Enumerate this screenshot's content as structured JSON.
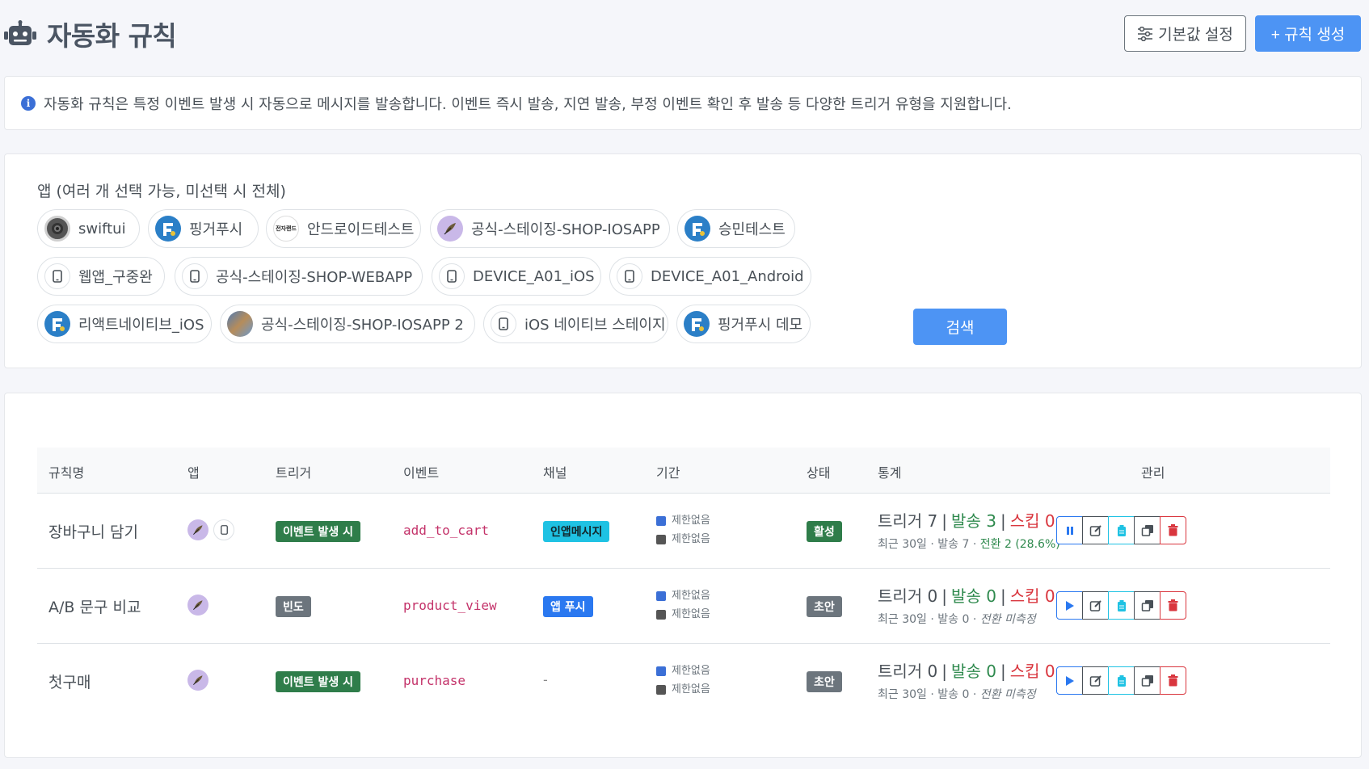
{
  "header": {
    "title": "자동화 규칙",
    "defaults_button": "기본값 설정",
    "create_button": "+ 규칙 생성"
  },
  "info": {
    "text": "자동화 규칙은 특정 이벤트 발생 시 자동으로 메시지를 발송합니다. 이벤트 즉시 발송, 지연 발송, 부정 이벤트 확인 후 발송 등 다양한 트리거 유형을 지원합니다."
  },
  "filter": {
    "label": "앱 (여러 개 선택 가능, 미선택 시 전체)",
    "search_button": "검색",
    "apps": [
      {
        "name": "swiftui",
        "icon": "swift-app-icon"
      },
      {
        "name": "핑거푸시",
        "icon": "fingerpush-logo-icon"
      },
      {
        "name": "안드로이드테스트",
        "icon": "text-logo-icon",
        "icon_text": "전자랜드"
      },
      {
        "name": "공식-스테이징-SHOP-IOSAPP",
        "icon": "feather-app-icon"
      },
      {
        "name": "승민테스트",
        "icon": "fingerpush-logo-icon"
      },
      {
        "name": "웹앱_구중완",
        "icon": "device-icon"
      },
      {
        "name": "공식-스테이징-SHOP-WEBAPP",
        "icon": "device-icon"
      },
      {
        "name": "DEVICE_A01_iOS",
        "icon": "device-icon"
      },
      {
        "name": "DEVICE_A01_Android",
        "icon": "device-icon"
      },
      {
        "name": "리액트네이티브_iOS",
        "icon": "fingerpush-logo-icon"
      },
      {
        "name": "공식-스테이징-SHOP-IOSAPP 2",
        "icon": "photo-app-icon"
      },
      {
        "name": "iOS 네이티브 스테이지",
        "icon": "device-icon"
      },
      {
        "name": "핑거푸시 데모",
        "icon": "fingerpush-logo-icon"
      }
    ]
  },
  "table": {
    "columns": [
      "규칙명",
      "앱",
      "트리거",
      "이벤트",
      "채널",
      "기간",
      "상태",
      "통계",
      "관리"
    ],
    "rows": [
      {
        "name": "장바구니 담기",
        "trigger": "이벤트 발생 시",
        "event": "add_to_cart",
        "channel": "인앱메시지",
        "period_start": "제한없음",
        "period_end": "제한없음",
        "status": "활성",
        "stats_trigger": "트리거 7",
        "stats_sent": "발송 3",
        "stats_skip": "스킵 0",
        "sub_period": "최근 30일",
        "sub_sent": "발송 7",
        "sub_conv": "전환 2 (28.6%)"
      },
      {
        "name": "A/B 문구 비교",
        "trigger": "빈도",
        "event": "product_view",
        "channel": "앱 푸시",
        "period_start": "제한없음",
        "period_end": "제한없음",
        "status": "초안",
        "stats_trigger": "트리거 0",
        "stats_sent": "발송 0",
        "stats_skip": "스킵 0",
        "sub_period": "최근 30일",
        "sub_sent": "발송 0",
        "sub_conv": "전환 미측정"
      },
      {
        "name": "첫구매",
        "trigger": "이벤트 발생 시",
        "event": "purchase",
        "channel": "-",
        "period_start": "제한없음",
        "period_end": "제한없음",
        "status": "초안",
        "stats_trigger": "트리거 0",
        "stats_sent": "발송 0",
        "stats_skip": "스킵 0",
        "sub_period": "최근 30일",
        "sub_sent": "발송 0",
        "sub_conv": "전환 미측정"
      }
    ]
  },
  "colors": {
    "primary": "#4d94f4",
    "success": "#2f7d4a",
    "danger": "#d9363e",
    "info": "#1fc2e3",
    "secondary": "#6c757d"
  }
}
